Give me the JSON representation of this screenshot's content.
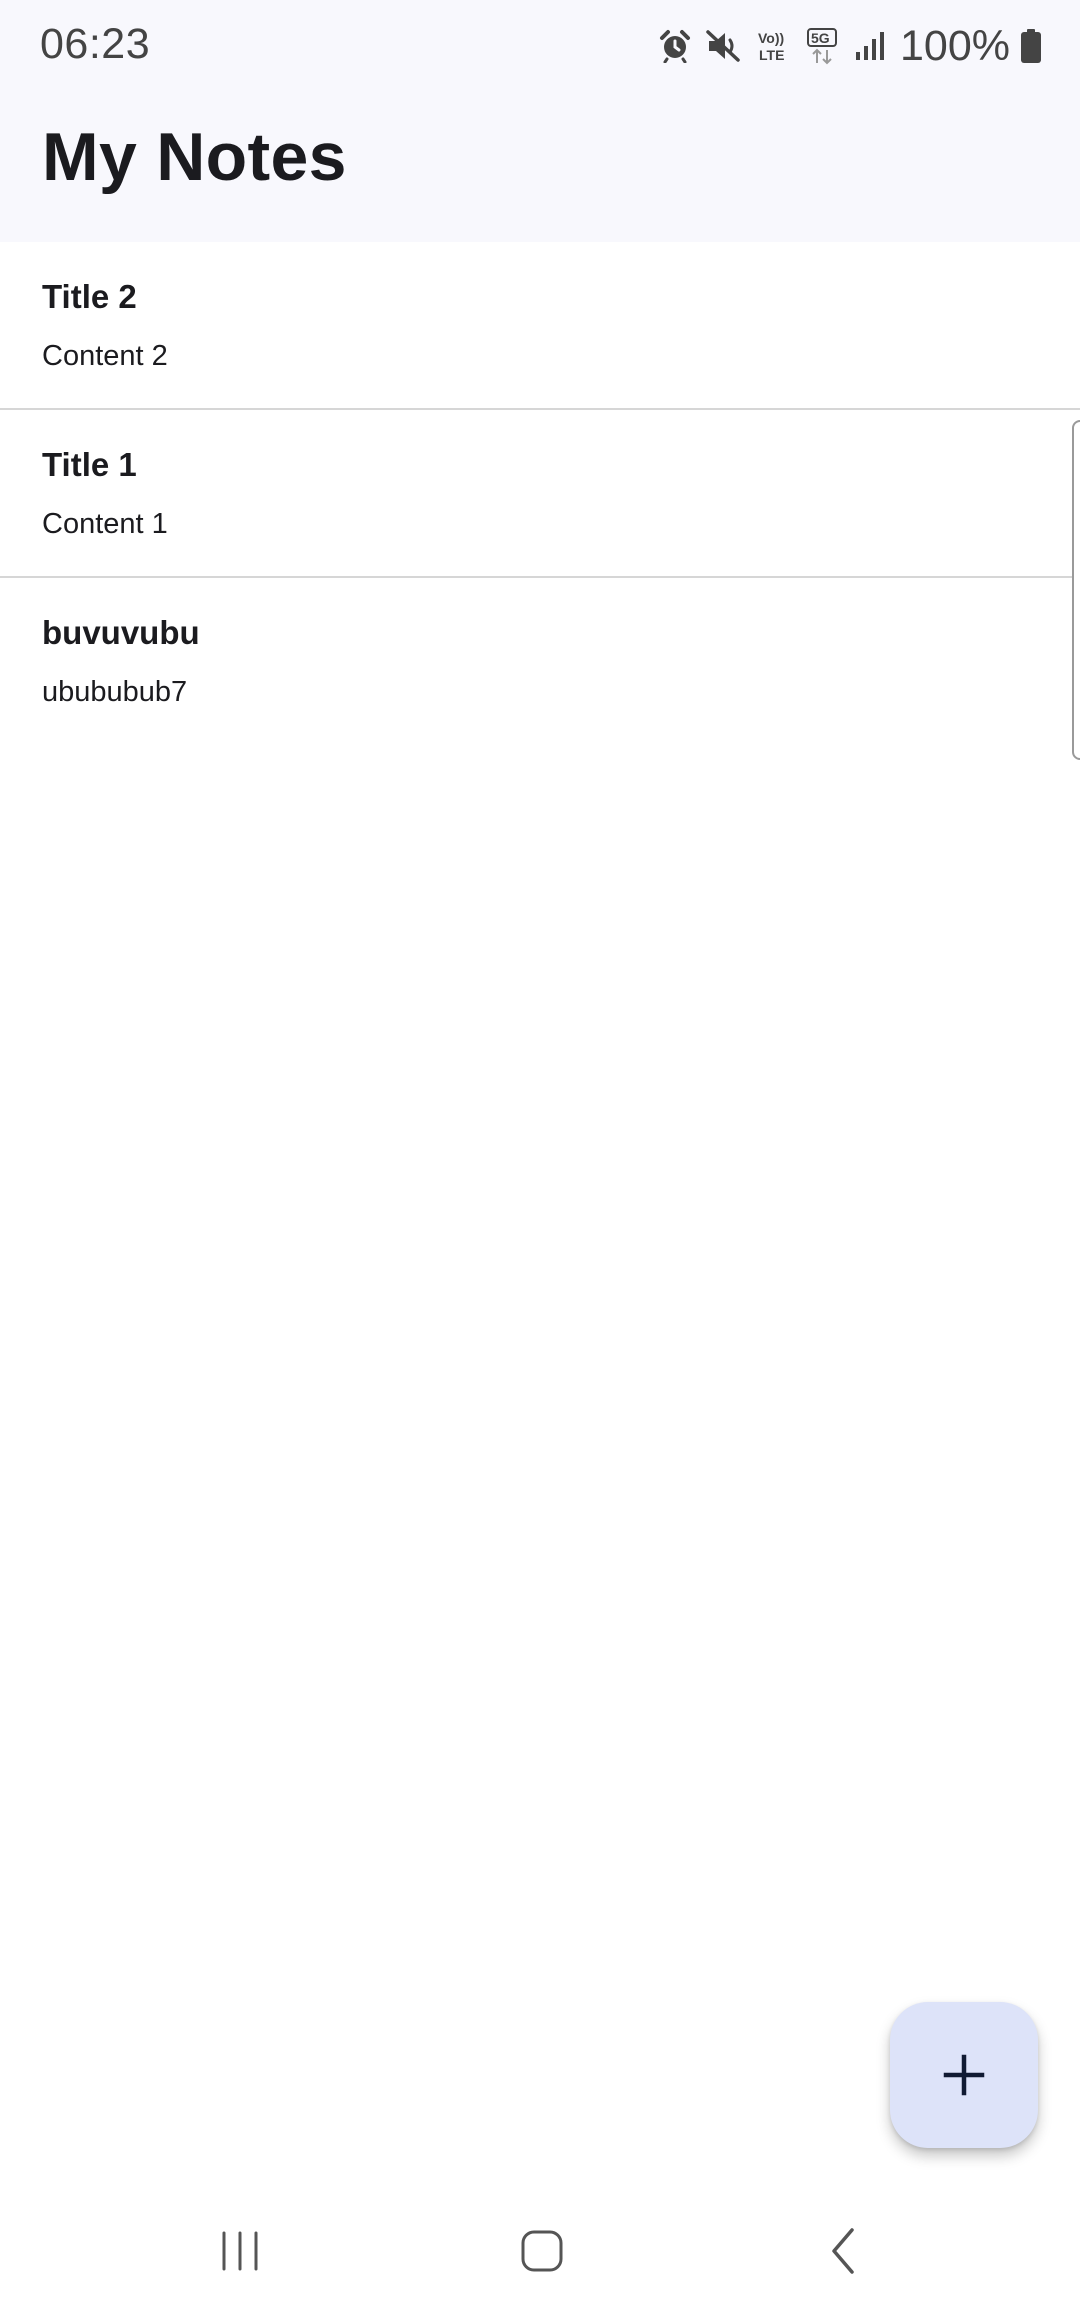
{
  "status_bar": {
    "time": "06:23",
    "battery": "100%",
    "icons": [
      "alarm-icon",
      "mute-icon",
      "volte-icon",
      "5g-icon",
      "signal-icon",
      "battery-icon"
    ]
  },
  "app_bar": {
    "title": "My Notes"
  },
  "notes": [
    {
      "title": "Title 2",
      "content": "Content 2"
    },
    {
      "title": "Title 1",
      "content": "Content 1"
    },
    {
      "title": "buvuvubu",
      "content": "ubububub7"
    }
  ],
  "fab": {
    "icon": "plus-icon"
  },
  "nav_bar": {
    "icons": [
      "recent-apps-icon",
      "home-icon",
      "back-icon"
    ]
  },
  "colors": {
    "app_bar_bg": "#f8f8fd",
    "fab_bg": "#dde3f9",
    "text": "#1b1b1f",
    "divider": "#d6d6d6"
  }
}
